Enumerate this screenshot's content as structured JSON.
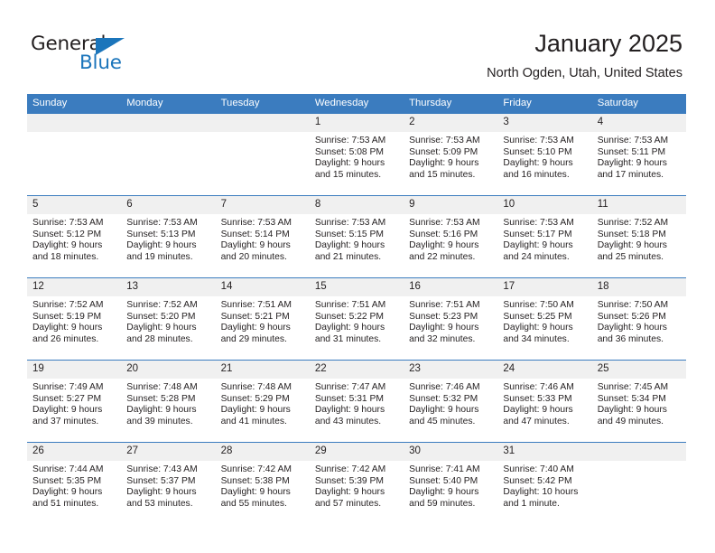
{
  "brand": {
    "name_top": "General",
    "name_bottom": "Blue",
    "accent_color": "#1b75bb",
    "triangle_icon": "triangle-icon"
  },
  "header": {
    "title": "January 2025",
    "subtitle": "North Ogden, Utah, United States"
  },
  "calendar": {
    "header_bg": "#3b7cbf",
    "daynum_bg": "#f0f0f0",
    "weekdays": [
      "Sunday",
      "Monday",
      "Tuesday",
      "Wednesday",
      "Thursday",
      "Friday",
      "Saturday"
    ],
    "weeks": [
      [
        {
          "day": "",
          "blank": true
        },
        {
          "day": "",
          "blank": true
        },
        {
          "day": "",
          "blank": true
        },
        {
          "day": "1",
          "sunrise": "Sunrise: 7:53 AM",
          "sunset": "Sunset: 5:08 PM",
          "daylight1": "Daylight: 9 hours",
          "daylight2": "and 15 minutes."
        },
        {
          "day": "2",
          "sunrise": "Sunrise: 7:53 AM",
          "sunset": "Sunset: 5:09 PM",
          "daylight1": "Daylight: 9 hours",
          "daylight2": "and 15 minutes."
        },
        {
          "day": "3",
          "sunrise": "Sunrise: 7:53 AM",
          "sunset": "Sunset: 5:10 PM",
          "daylight1": "Daylight: 9 hours",
          "daylight2": "and 16 minutes."
        },
        {
          "day": "4",
          "sunrise": "Sunrise: 7:53 AM",
          "sunset": "Sunset: 5:11 PM",
          "daylight1": "Daylight: 9 hours",
          "daylight2": "and 17 minutes."
        }
      ],
      [
        {
          "day": "5",
          "sunrise": "Sunrise: 7:53 AM",
          "sunset": "Sunset: 5:12 PM",
          "daylight1": "Daylight: 9 hours",
          "daylight2": "and 18 minutes."
        },
        {
          "day": "6",
          "sunrise": "Sunrise: 7:53 AM",
          "sunset": "Sunset: 5:13 PM",
          "daylight1": "Daylight: 9 hours",
          "daylight2": "and 19 minutes."
        },
        {
          "day": "7",
          "sunrise": "Sunrise: 7:53 AM",
          "sunset": "Sunset: 5:14 PM",
          "daylight1": "Daylight: 9 hours",
          "daylight2": "and 20 minutes."
        },
        {
          "day": "8",
          "sunrise": "Sunrise: 7:53 AM",
          "sunset": "Sunset: 5:15 PM",
          "daylight1": "Daylight: 9 hours",
          "daylight2": "and 21 minutes."
        },
        {
          "day": "9",
          "sunrise": "Sunrise: 7:53 AM",
          "sunset": "Sunset: 5:16 PM",
          "daylight1": "Daylight: 9 hours",
          "daylight2": "and 22 minutes."
        },
        {
          "day": "10",
          "sunrise": "Sunrise: 7:53 AM",
          "sunset": "Sunset: 5:17 PM",
          "daylight1": "Daylight: 9 hours",
          "daylight2": "and 24 minutes."
        },
        {
          "day": "11",
          "sunrise": "Sunrise: 7:52 AM",
          "sunset": "Sunset: 5:18 PM",
          "daylight1": "Daylight: 9 hours",
          "daylight2": "and 25 minutes."
        }
      ],
      [
        {
          "day": "12",
          "sunrise": "Sunrise: 7:52 AM",
          "sunset": "Sunset: 5:19 PM",
          "daylight1": "Daylight: 9 hours",
          "daylight2": "and 26 minutes."
        },
        {
          "day": "13",
          "sunrise": "Sunrise: 7:52 AM",
          "sunset": "Sunset: 5:20 PM",
          "daylight1": "Daylight: 9 hours",
          "daylight2": "and 28 minutes."
        },
        {
          "day": "14",
          "sunrise": "Sunrise: 7:51 AM",
          "sunset": "Sunset: 5:21 PM",
          "daylight1": "Daylight: 9 hours",
          "daylight2": "and 29 minutes."
        },
        {
          "day": "15",
          "sunrise": "Sunrise: 7:51 AM",
          "sunset": "Sunset: 5:22 PM",
          "daylight1": "Daylight: 9 hours",
          "daylight2": "and 31 minutes."
        },
        {
          "day": "16",
          "sunrise": "Sunrise: 7:51 AM",
          "sunset": "Sunset: 5:23 PM",
          "daylight1": "Daylight: 9 hours",
          "daylight2": "and 32 minutes."
        },
        {
          "day": "17",
          "sunrise": "Sunrise: 7:50 AM",
          "sunset": "Sunset: 5:25 PM",
          "daylight1": "Daylight: 9 hours",
          "daylight2": "and 34 minutes."
        },
        {
          "day": "18",
          "sunrise": "Sunrise: 7:50 AM",
          "sunset": "Sunset: 5:26 PM",
          "daylight1": "Daylight: 9 hours",
          "daylight2": "and 36 minutes."
        }
      ],
      [
        {
          "day": "19",
          "sunrise": "Sunrise: 7:49 AM",
          "sunset": "Sunset: 5:27 PM",
          "daylight1": "Daylight: 9 hours",
          "daylight2": "and 37 minutes."
        },
        {
          "day": "20",
          "sunrise": "Sunrise: 7:48 AM",
          "sunset": "Sunset: 5:28 PM",
          "daylight1": "Daylight: 9 hours",
          "daylight2": "and 39 minutes."
        },
        {
          "day": "21",
          "sunrise": "Sunrise: 7:48 AM",
          "sunset": "Sunset: 5:29 PM",
          "daylight1": "Daylight: 9 hours",
          "daylight2": "and 41 minutes."
        },
        {
          "day": "22",
          "sunrise": "Sunrise: 7:47 AM",
          "sunset": "Sunset: 5:31 PM",
          "daylight1": "Daylight: 9 hours",
          "daylight2": "and 43 minutes."
        },
        {
          "day": "23",
          "sunrise": "Sunrise: 7:46 AM",
          "sunset": "Sunset: 5:32 PM",
          "daylight1": "Daylight: 9 hours",
          "daylight2": "and 45 minutes."
        },
        {
          "day": "24",
          "sunrise": "Sunrise: 7:46 AM",
          "sunset": "Sunset: 5:33 PM",
          "daylight1": "Daylight: 9 hours",
          "daylight2": "and 47 minutes."
        },
        {
          "day": "25",
          "sunrise": "Sunrise: 7:45 AM",
          "sunset": "Sunset: 5:34 PM",
          "daylight1": "Daylight: 9 hours",
          "daylight2": "and 49 minutes."
        }
      ],
      [
        {
          "day": "26",
          "sunrise": "Sunrise: 7:44 AM",
          "sunset": "Sunset: 5:35 PM",
          "daylight1": "Daylight: 9 hours",
          "daylight2": "and 51 minutes."
        },
        {
          "day": "27",
          "sunrise": "Sunrise: 7:43 AM",
          "sunset": "Sunset: 5:37 PM",
          "daylight1": "Daylight: 9 hours",
          "daylight2": "and 53 minutes."
        },
        {
          "day": "28",
          "sunrise": "Sunrise: 7:42 AM",
          "sunset": "Sunset: 5:38 PM",
          "daylight1": "Daylight: 9 hours",
          "daylight2": "and 55 minutes."
        },
        {
          "day": "29",
          "sunrise": "Sunrise: 7:42 AM",
          "sunset": "Sunset: 5:39 PM",
          "daylight1": "Daylight: 9 hours",
          "daylight2": "and 57 minutes."
        },
        {
          "day": "30",
          "sunrise": "Sunrise: 7:41 AM",
          "sunset": "Sunset: 5:40 PM",
          "daylight1": "Daylight: 9 hours",
          "daylight2": "and 59 minutes."
        },
        {
          "day": "31",
          "sunrise": "Sunrise: 7:40 AM",
          "sunset": "Sunset: 5:42 PM",
          "daylight1": "Daylight: 10 hours",
          "daylight2": "and 1 minute."
        },
        {
          "day": "",
          "blank": true
        }
      ]
    ]
  }
}
